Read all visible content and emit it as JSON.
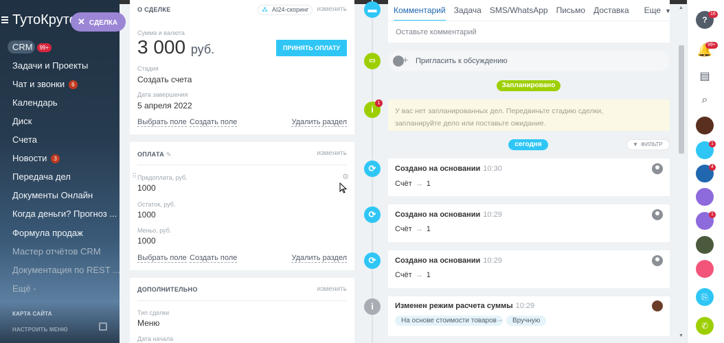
{
  "sidebar": {
    "logo": "ТутоКруто",
    "create_button": "СДЕЛКА",
    "items": [
      {
        "label": "CRM",
        "counter": "99+"
      },
      {
        "label": "Задачи и Проекты"
      },
      {
        "label": "Чат и звонки",
        "counter": "6"
      },
      {
        "label": "Календарь"
      },
      {
        "label": "Диск"
      },
      {
        "label": "Счета"
      },
      {
        "label": "Новости",
        "counter": "3"
      },
      {
        "label": "Передача дел"
      },
      {
        "label": "Документы Онлайн"
      },
      {
        "label": "Когда деньги? Прогноз ..."
      },
      {
        "label": "Формула продаж"
      },
      {
        "label": "Мастер отчётов CRM"
      },
      {
        "label": "Документация по REST ..."
      },
      {
        "label": "Ещё -"
      }
    ],
    "sitemap": "КАРТА САЙТА",
    "settings": "НАСТРОИТЬ МЕНЮ"
  },
  "about": {
    "title": "О СДЕЛКЕ",
    "scoring": "AI24-скоринг",
    "change": "изменить",
    "amount_label": "Сумма и валюта",
    "amount": "3 000",
    "currency": "руб.",
    "accept_button": "ПРИНЯТЬ ОПЛАТУ",
    "stage_label": "Стадия",
    "stage": "Создать счета",
    "close_label": "Дата завершения",
    "close_date": "5 апреля 2022",
    "select_field": "Выбрать поле",
    "create_field": "Создать поле",
    "delete_section": "Удалить раздел"
  },
  "payment": {
    "title": "ОПЛАТА",
    "change": "изменить",
    "prepay_label": "Предоплата, руб.",
    "prepay": "1000",
    "rest_label": "Остаток, руб.",
    "rest": "1000",
    "less_label": "Меньо, руб.",
    "less": "1000",
    "select_field": "Выбрать поле",
    "create_field": "Создать поле",
    "delete_section": "Удалить раздел"
  },
  "extra": {
    "title": "ДОПОЛНИТЕЛЬНО",
    "change": "изменить",
    "type_label": "Тип сделки",
    "type": "Меню",
    "start_label": "Дата начала"
  },
  "tabs": [
    "Комментарий",
    "Задача",
    "SMS/WhatsApp",
    "Письмо",
    "Доставка",
    "Еще"
  ],
  "comment_placeholder": "Оставьте комментарий",
  "invite": "Пригласить к обсуждению",
  "planned_pill": "Запланировано",
  "planned_badge": "1",
  "no_planned": "У вас нет запланированных дел. Передвиньте стадию сделки, запланируйте дело или поставьте ожидание.",
  "today_pill": "сегодня",
  "filter": "ФИЛЬТР",
  "entries": [
    {
      "title": "Создано на основании",
      "time": "10:30",
      "left": "Счёт",
      "right": "1"
    },
    {
      "title": "Создано на основании",
      "time": "10:29",
      "left": "Счёт",
      "right": "1"
    },
    {
      "title": "Создано на основании",
      "time": "10:29",
      "left": "Счёт",
      "right": "1"
    }
  ],
  "mode_entry": {
    "title": "Изменен режим расчета суммы",
    "time": "10:29",
    "from": "На основе стоимости товаров",
    "to": "Вручную"
  },
  "right_panel": {
    "help_badge": "16",
    "bell_badge": "99+",
    "avatar_badge_1": "1",
    "avatar_badge_2": "4",
    "avatar_badge_3": "1"
  },
  "colors": {
    "accent": "#2fc6f6",
    "timeline_icon": "#2fc6f6",
    "green": "#9dcf00",
    "purple_button": "#9b86d6"
  }
}
